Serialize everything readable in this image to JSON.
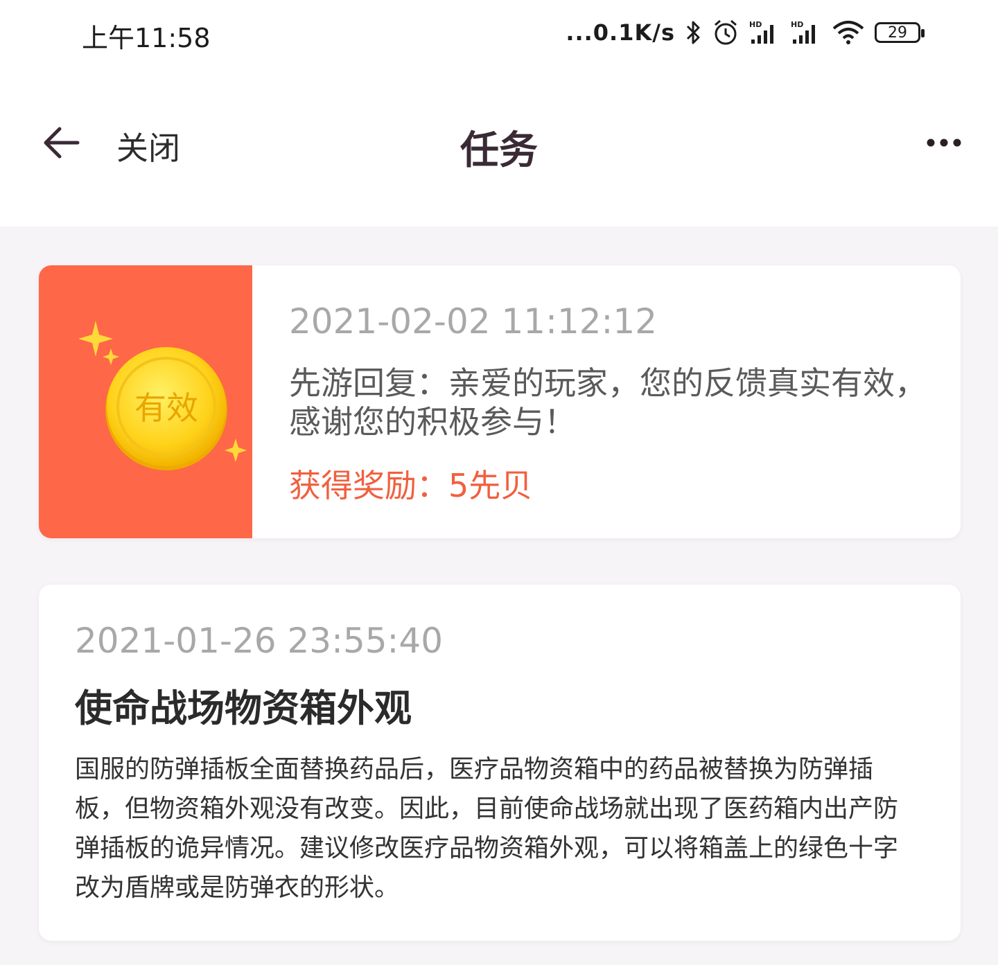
{
  "status_bar": {
    "time": "上午11:58",
    "net_speed": "...0.1K/s",
    "battery": "29",
    "icons": [
      "bluetooth-icon",
      "alarm-icon",
      "hd-signal-icon",
      "hd-signal-icon",
      "wifi-icon",
      "battery-icon"
    ]
  },
  "header": {
    "back_icon": "arrow-left-icon",
    "close_label": "关闭",
    "title": "任务",
    "more_icon": "more-dots-icon"
  },
  "tasks": [
    {
      "badge_text": "有效",
      "date": "2021-02-02 11:12:12",
      "message": "先游回复：亲爱的玩家，您的反馈真实有效，感谢您的积极参与！",
      "reward": "获得奖励：5先贝",
      "accent_color": "#fe6748"
    },
    {
      "date": "2021-01-26 23:55:40",
      "title": "使命战场物资箱外观",
      "body": "国服的防弹插板全面替换药品后，医疗品物资箱中的药品被替换为防弹插板，但物资箱外观没有改变。因此，目前使命战场就出现了医药箱内出产防弹插板的诡异情况。建议修改医疗品物资箱外观，可以将箱盖上的绿色十字改为盾牌或是防弹衣的形状。"
    }
  ]
}
